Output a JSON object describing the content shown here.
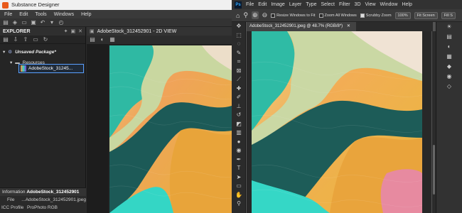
{
  "substance": {
    "title": "Substance Designer",
    "menu": [
      "File",
      "Edit",
      "Tools",
      "Windows",
      "Help"
    ],
    "explorer": {
      "title": "EXPLORER",
      "package": "Unsaved Package*",
      "folder": "Resources",
      "file": "AdobeStock_31245..."
    },
    "info": {
      "label": "Information",
      "name": "AdobeStock_312452901",
      "rows": [
        {
          "key": "File",
          "value": "...AdobeStock_312452901.jpeg"
        },
        {
          "key": "ICC Profile",
          "value": "ProPhoto RGB"
        }
      ]
    },
    "view": {
      "title": "AdobeStock_312452901 - 2D VIEW"
    }
  },
  "photoshop": {
    "logo": "Ps",
    "menu": [
      "File",
      "Edit",
      "Image",
      "Layer",
      "Type",
      "Select",
      "Filter",
      "3D",
      "View",
      "Window",
      "Help"
    ],
    "options": {
      "resize": "Resize Windows to Fit",
      "zoom_all": "Zoom All Windows",
      "scrubby": "Scrubby Zoom",
      "percent": "100%",
      "fit": "Fit Screen",
      "fill": "Fill S"
    },
    "tab": "AdobeStock_312452901.jpeg @ 48.7% (RGB/8*)"
  }
}
